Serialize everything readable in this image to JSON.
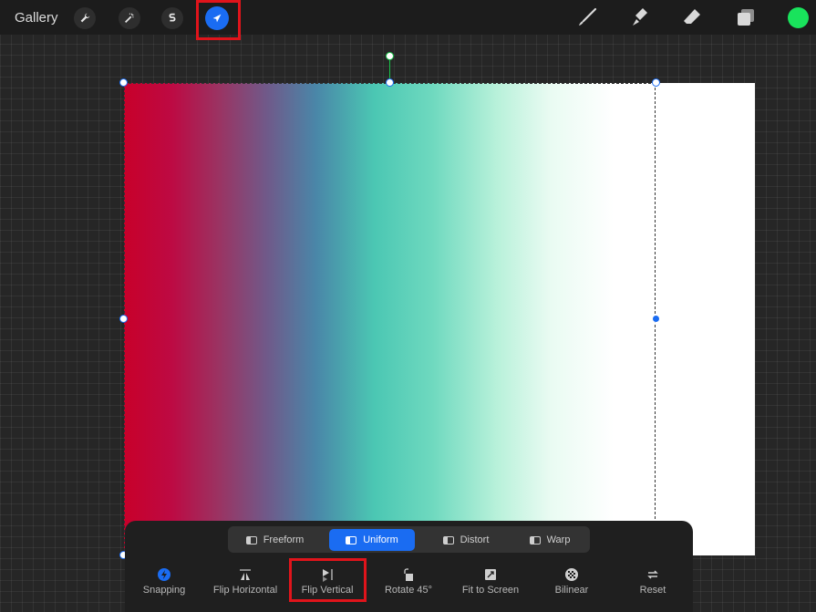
{
  "toolbar": {
    "gallery_label": "Gallery",
    "left_tools": [
      "wrench-icon",
      "magic-wand-icon",
      "selection-s-icon",
      "transform-arrow-icon"
    ],
    "right_tools": [
      "brush-icon",
      "smudge-icon",
      "eraser-icon",
      "layers-icon"
    ],
    "current_color": "#19e35c"
  },
  "transform_modes": {
    "items": [
      {
        "label": "Freeform",
        "icon": "freeform-icon"
      },
      {
        "label": "Uniform",
        "icon": "uniform-icon"
      },
      {
        "label": "Distort",
        "icon": "distort-icon"
      },
      {
        "label": "Warp",
        "icon": "warp-icon"
      }
    ],
    "selected": "Uniform"
  },
  "transform_actions": [
    {
      "label": "Snapping",
      "icon": "snapping-icon"
    },
    {
      "label": "Flip Horizontal",
      "icon": "flip-horizontal-icon"
    },
    {
      "label": "Flip Vertical",
      "icon": "flip-vertical-icon"
    },
    {
      "label": "Rotate 45°",
      "icon": "rotate-icon"
    },
    {
      "label": "Fit to Screen",
      "icon": "fit-screen-icon"
    },
    {
      "label": "Bilinear",
      "icon": "bilinear-icon"
    },
    {
      "label": "Reset",
      "icon": "reset-icon"
    }
  ],
  "accent_color": "#1a6cf2",
  "highlight_color": "#e0141b"
}
